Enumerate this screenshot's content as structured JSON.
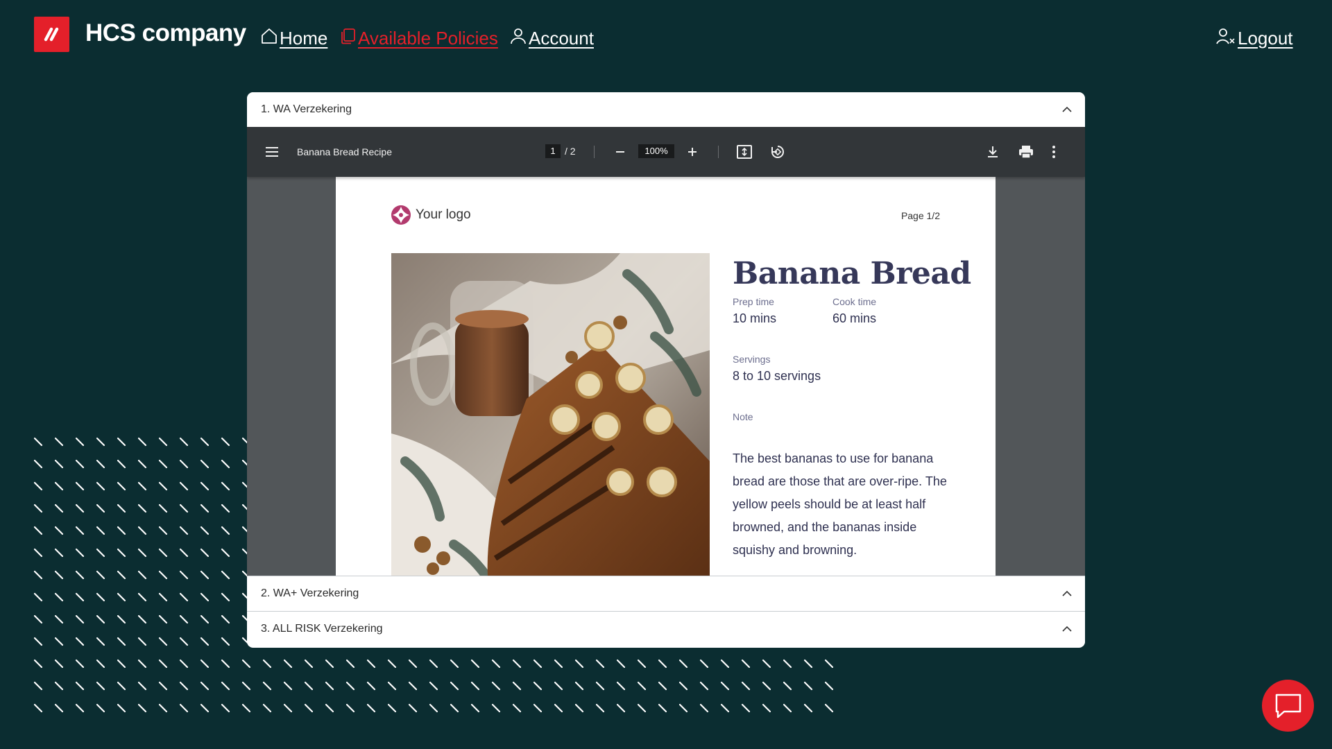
{
  "brand": {
    "name": "HCS company",
    "logo_icon": "hcs-slashes-logo"
  },
  "nav": {
    "home": "Home",
    "policies": "Available Policies",
    "account": "Account",
    "logout": "Logout",
    "active_color": "#e4202a"
  },
  "accordion": [
    {
      "title": "1. WA Verzekering",
      "expanded": true
    },
    {
      "title": "2. WA+ Verzekering",
      "expanded": false
    },
    {
      "title": "3. ALL RISK Verzekering",
      "expanded": false
    }
  ],
  "pdf": {
    "file_title": "Banana Bread Recipe",
    "current_page": "1",
    "total_pages": "/ 2",
    "zoom": "100%",
    "toolbar_icons": [
      "menu-icon",
      "zoom-out-icon",
      "zoom-in-icon",
      "fit-page-icon",
      "rotate-icon",
      "download-icon",
      "print-icon",
      "more-options-icon"
    ],
    "document": {
      "logo_text": "Your logo",
      "page_label": "Page 1/2",
      "title": "Banana Bread",
      "prep_label": "Prep time",
      "prep_value": "10 mins",
      "cook_label": "Cook time",
      "cook_value": "60 mins",
      "servings_label": "Servings",
      "servings_value": "8 to 10 servings",
      "note_label": "Note",
      "note_text": "The best bananas to use for banana bread are those that are over-ripe. The yellow peels should be at least half browned, and the bananas inside squishy and browning."
    }
  },
  "colors": {
    "background": "#0b2d31",
    "accent": "#e4202a",
    "title": "#363859"
  }
}
